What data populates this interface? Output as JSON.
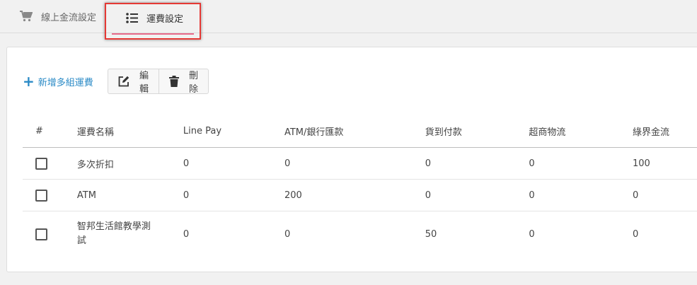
{
  "tabs": [
    {
      "label": "線上金流設定",
      "icon": "cart-icon"
    },
    {
      "label": "運費設定",
      "icon": "list-icon"
    }
  ],
  "toolbar": {
    "add_label": "新增多組運費",
    "edit_label": "編輯",
    "delete_label": "刪除"
  },
  "table": {
    "headers": [
      "#",
      "運費名稱",
      "Line Pay",
      "ATM/銀行匯款",
      "貨到付款",
      "超商物流",
      "綠界金流"
    ],
    "rows": [
      {
        "name": "多次折扣",
        "linepay": "0",
        "atm": "0",
        "cod": "0",
        "cvs": "0",
        "ecpay": "100"
      },
      {
        "name": "ATM",
        "linepay": "0",
        "atm": "200",
        "cod": "0",
        "cvs": "0",
        "ecpay": "0"
      },
      {
        "name": "智邦生活館教學測試",
        "linepay": "0",
        "atm": "0",
        "cod": "50",
        "cvs": "0",
        "ecpay": "0"
      }
    ]
  },
  "colors": {
    "accent": "#2a8ac6",
    "highlight_border": "#e53935",
    "tab_underline": "#e76a8a"
  }
}
